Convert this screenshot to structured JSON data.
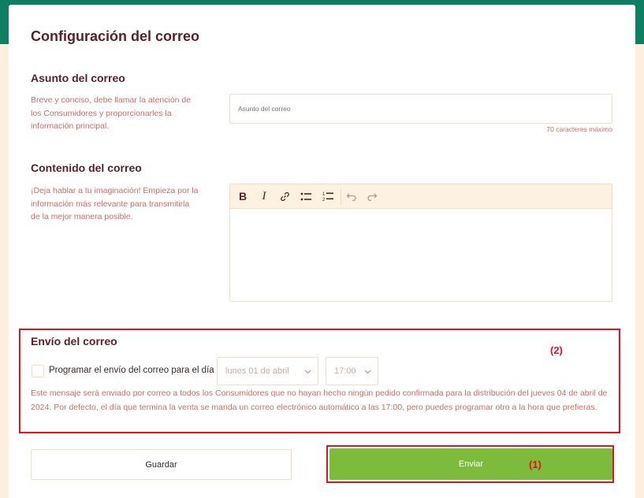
{
  "page": {
    "title": "Configuración del correo"
  },
  "subject": {
    "heading": "Asunto del correo",
    "help": "Breve y conciso, debe llamar la atención de los Consumidores y proporcionarles la información principal.",
    "placeholder": "Asunto del correo",
    "value": "",
    "counter": "70 caracteres máximo"
  },
  "content": {
    "heading": "Contenido del correo",
    "help": "¡Deja hablar a tu imaginación! Empieza por la información más relevante para transmitirla de la mejor manera posible.",
    "toolbar": {
      "bold": "B",
      "italic": "I",
      "icons": [
        "bold-icon",
        "italic-icon",
        "link-icon",
        "bullet-list-icon",
        "numbered-list-icon",
        "undo-icon",
        "redo-icon"
      ]
    },
    "body": ""
  },
  "sending": {
    "heading": "Envío del correo",
    "annotation": "(2)",
    "checkbox_label": "Programar el envío del correo para el día",
    "checked": false,
    "date_value": "lunes 01 de abril",
    "time_value": "17:00",
    "note": "Este mensaje será enviado por correo a todos los Consumidores que no hayan hecho ningún pedido confirmada para la distribución del jueves 04 de abril de 2024. Por defecto, el día que termina la venta se manda un correo electrónico automático a las 17:00, pero puedes programar otro a la hora que prefieras."
  },
  "actions": {
    "save_label": "Guardar",
    "send_label": "Enviar",
    "send_annotation": "(1)"
  },
  "colors": {
    "brand_bar": "#0f7f62",
    "background": "#fdeedd",
    "heading": "#5b1f2a",
    "help_text": "#d16d62",
    "send_button": "#7dbb3c",
    "annotation": "#e2141c"
  }
}
